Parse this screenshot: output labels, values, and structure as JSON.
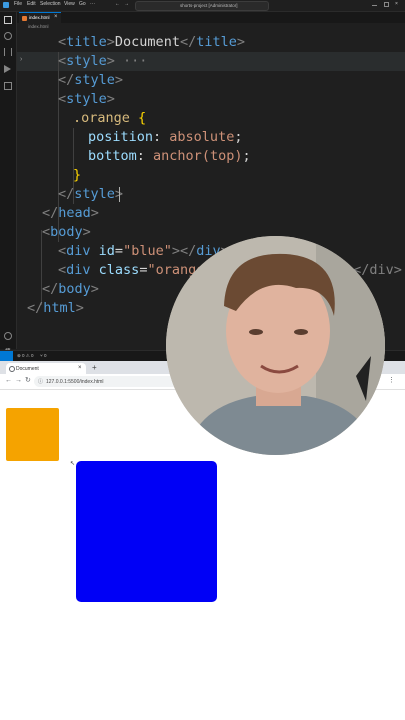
{
  "titlebar": {
    "menu": [
      "File",
      "Edit",
      "Selection",
      "View",
      "Go"
    ],
    "more": "···",
    "command_center": "shorts-project [Administrator]"
  },
  "tab": {
    "label": "index.html",
    "close": "×"
  },
  "breadcrumb": "index.html",
  "editor": {
    "lines": {
      "l1": {
        "o": "<",
        "tag": "title",
        "c": ">",
        "text": "Document",
        "o2": "</",
        "tag2": "title",
        "c2": ">"
      },
      "l2": {
        "o": "<",
        "tag": "style",
        "c": ">",
        "fold": " ···"
      },
      "l3": {
        "o": "</",
        "tag": "style",
        "c": ">"
      },
      "l4": {
        "o": "<",
        "tag": "style",
        "c": ">"
      },
      "l5": {
        "sel": ".orange",
        "br": " {"
      },
      "l6": {
        "prop": "position",
        "colon": ": ",
        "val": "absolute",
        "semi": ";"
      },
      "l7": {
        "prop": "bottom",
        "colon": ": ",
        "val": "anchor(top)",
        "semi": ";"
      },
      "l8": {
        "br": "}"
      },
      "l9": {
        "o": "</",
        "tag": "style",
        "c": ">"
      },
      "l10": {
        "o": "</",
        "tag": "head",
        "c": ">"
      },
      "l11": {
        "o": "<",
        "tag": "body",
        "c": ">"
      },
      "l12": {
        "o": "<",
        "tag": "div",
        "attr": " id",
        "eq": "=",
        "str": "\"blue\"",
        "c": ">",
        "o2": "</",
        "tag2": "div",
        "c2": ">"
      },
      "l13": {
        "o": "<",
        "tag": "div",
        "attr": " class",
        "eq": "=",
        "str": "\"orange\"",
        "rest": "></div>"
      },
      "l14": {
        "o": "</",
        "tag": "body",
        "c": ">"
      },
      "l15": {
        "o": "</",
        "tag": "html",
        "c": ">"
      }
    }
  },
  "statusbar": {
    "errors": "⊗ 0 ⚠ 0",
    "ports": "⑂ 0"
  },
  "browser": {
    "tab_title": "Document",
    "new_tab": "+",
    "url": "127.0.0.1:5500/index.html",
    "back": "←",
    "forward": "→",
    "reload": "↻"
  },
  "colors": {
    "orange_box": "#f5a300",
    "blue_box": "#0000f6",
    "editor_bg": "#1f1f1f",
    "accent": "#0078d4"
  },
  "icons": {
    "activity": [
      "explorer-icon",
      "search-icon",
      "source-control-icon",
      "run-debug-icon",
      "extensions-icon",
      "account-icon",
      "settings-icon"
    ]
  }
}
